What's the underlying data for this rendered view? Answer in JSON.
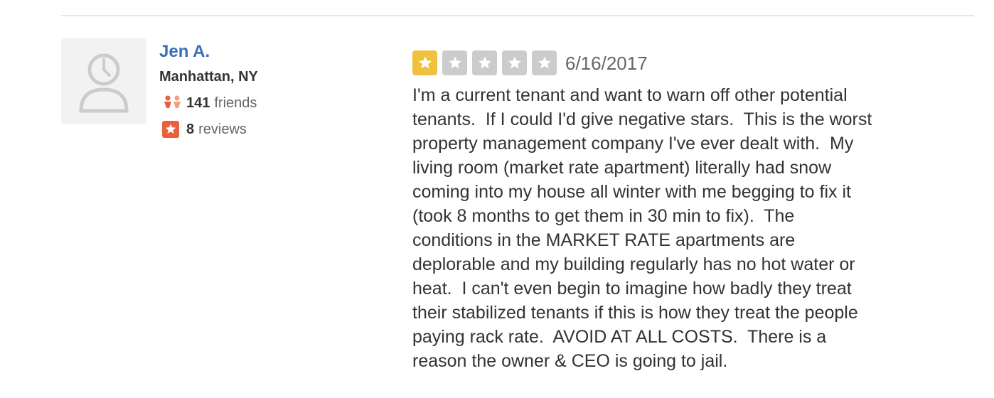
{
  "review": {
    "user": {
      "name": "Jen A.",
      "location": "Manhattan, NY",
      "friends_count": "141",
      "friends_label": "friends",
      "reviews_count": "8",
      "reviews_label": "reviews"
    },
    "rating": {
      "value": 1,
      "max": 5
    },
    "date": "6/16/2017",
    "text": "I'm a current tenant and want to warn off other potential\ntenants.  If I could I'd give negative stars.  This is the worst\nproperty management company I've ever dealt with.  My\nliving room (market rate apartment) literally had snow\ncoming into my house all winter with me begging to fix it\n(took 8 months to get them in 30 min to fix).  The\nconditions in the MARKET RATE apartments are\ndeplorable and my building regularly has no hot water or\nheat.  I can't even begin to imagine how badly they treat\ntheir stabilized tenants if this is how they treat the people\npaying rack rate.  AVOID AT ALL COSTS.  There is a\nreason the owner & CEO is going to jail."
  },
  "icons": {
    "avatar": "default-user-avatar-icon",
    "friends": "friends-icon",
    "reviews": "review-star-icon",
    "star": "star-icon"
  },
  "colors": {
    "name_link": "#3b6fb6",
    "star_filled": "#f0c13f",
    "star_empty": "#cccccc",
    "friends_icon": "#e8603c",
    "reviews_icon": "#e8603c"
  }
}
